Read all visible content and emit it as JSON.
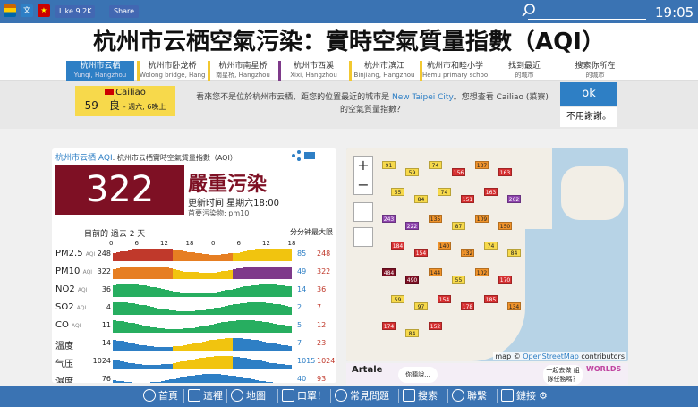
{
  "topbar": {
    "like_label": "Like 9.2K",
    "share_label": "Share",
    "clock": "19:05",
    "search_icon": "search-icon"
  },
  "title": "杭州市云栖空氣污染：實時空氣質量指數（AQI）",
  "tabs": [
    {
      "label": "杭州市云栖",
      "sub": "Yunqi, Hangzhou"
    },
    {
      "label": "杭州市卧龙桥",
      "sub": "Wolong bridge, Hang"
    },
    {
      "label": "杭州市南星桥",
      "sub": "南星桥, Hangzhou"
    },
    {
      "label": "杭州市西溪",
      "sub": "Xixi, Hangzhou"
    },
    {
      "label": "杭州市滨江",
      "sub": "Binjiang, Hangzhou"
    },
    {
      "label": "杭州市和睦小学",
      "sub": "Hemu primary schoo"
    },
    {
      "label": "找到最近",
      "sub": "的城市"
    },
    {
      "label": "搜索你所在",
      "sub": "的城市"
    }
  ],
  "notice": {
    "city": "Cailiao",
    "value": "59 - 良",
    "time": "- 週六, 6晚上",
    "text_a": "看來您不是位於杭州市云栖，距您的位置最近的城市是",
    "link": "New Taipei City",
    "text_b": "。您想查看 Cailiao (菜寮) 的空氣質量指數？",
    "ok_label": "ok",
    "no_label": "不用謝謝。"
  },
  "panel": {
    "title_city": "杭州市云栖 AQI",
    "title_desc": ": 杭州市云栖實時空氣質量指數（AQI）",
    "aqi": "322",
    "level": "嚴重污染",
    "updated": "更新时间 星期六18:00",
    "primary": "首要污染物: pm10",
    "hdr_past": "目前的 過去 2 天",
    "hdr_minmax": "分分钟最大限",
    "hours": [
      "0",
      "6",
      "12",
      "18",
      "0",
      "6",
      "12",
      "18"
    ],
    "rows": [
      {
        "label": "PM2.5",
        "unit": "AQI",
        "cur": "248",
        "min": "85",
        "max": "248"
      },
      {
        "label": "PM10",
        "unit": "AQI",
        "cur": "322",
        "min": "49",
        "max": "322"
      },
      {
        "label": "NO2",
        "unit": "AQI",
        "cur": "36",
        "min": "14",
        "max": "36"
      },
      {
        "label": "SO2",
        "unit": "AQI",
        "cur": "4",
        "min": "2",
        "max": "7"
      },
      {
        "label": "CO",
        "unit": "AQI",
        "cur": "11",
        "min": "5",
        "max": "12"
      },
      {
        "label": "溫度",
        "unit": "",
        "cur": "14",
        "min": "7",
        "max": "23"
      },
      {
        "label": "气压",
        "unit": "",
        "cur": "1024",
        "min": "1015",
        "max": "1024"
      },
      {
        "label": "濕度",
        "unit": "",
        "cur": "76",
        "min": "40",
        "max": "93"
      }
    ]
  },
  "map": {
    "zoom_in": "+",
    "zoom_out": "−",
    "attrib_a": "map © ",
    "attrib_link": "OpenStreetMap",
    "attrib_b": " contributors",
    "markers": [
      "91",
      "59",
      "74",
      "156",
      "137",
      "163",
      "55",
      "84",
      "74",
      "151",
      "163",
      "262",
      "243",
      "222",
      "135",
      "87",
      "109",
      "150",
      "184",
      "154",
      "140",
      "132",
      "74",
      "84",
      "484",
      "490",
      "144",
      "55",
      "102",
      "170",
      "59",
      "97",
      "154",
      "178",
      "185",
      "134",
      "174",
      "84",
      "152"
    ]
  },
  "ad": {
    "title": "Artale",
    "bubble1": "你聽說...",
    "bubble2": "一起去做 組隊任務嗎？",
    "logo": "WORLDS"
  },
  "bottom": {
    "items": [
      "首頁",
      "這裡",
      "地圖",
      "口罩！",
      "常見問題",
      "搜索",
      "聯繫",
      "鏈接"
    ]
  },
  "colors": {
    "accent": "#3a73b3",
    "aqi_hazard": "#7e1024",
    "good": "#f7d94b"
  }
}
